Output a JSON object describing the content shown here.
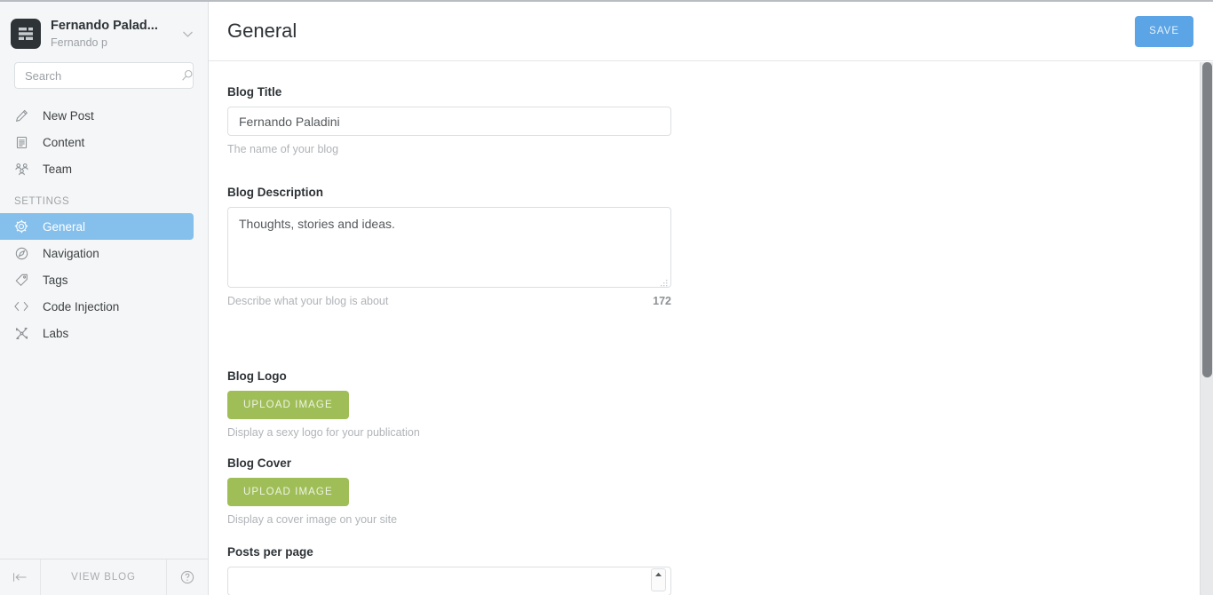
{
  "sidebar": {
    "brand": {
      "logo_icon": "ghost-logo-icon",
      "title": "Fernando Palad...",
      "subtitle": "Fernando p",
      "chevron_icon": "chevron-down-icon"
    },
    "search": {
      "placeholder": "Search",
      "value": "",
      "icon": "search-icon"
    },
    "primary_items": [
      {
        "label": "New Post",
        "icon": "pencil-icon",
        "active": false
      },
      {
        "label": "Content",
        "icon": "document-icon",
        "active": false
      },
      {
        "label": "Team",
        "icon": "team-icon",
        "active": false
      }
    ],
    "settings_heading": "SETTINGS",
    "settings_items": [
      {
        "label": "General",
        "icon": "gear-icon",
        "active": true
      },
      {
        "label": "Navigation",
        "icon": "compass-icon",
        "active": false
      },
      {
        "label": "Tags",
        "icon": "tag-icon",
        "active": false
      },
      {
        "label": "Code Injection",
        "icon": "code-brackets-icon",
        "active": false
      },
      {
        "label": "Labs",
        "icon": "tools-icon",
        "active": false
      }
    ],
    "footer": {
      "collapse_icon": "collapse-left-icon",
      "view_blog_label": "VIEW BLOG",
      "help_icon": "question-circle-icon"
    }
  },
  "header": {
    "title": "General",
    "save_label": "SAVE"
  },
  "form": {
    "blog_title": {
      "label": "Blog Title",
      "value": "Fernando Paladini",
      "placeholder": "Site title",
      "hint": "The name of your blog"
    },
    "blog_description": {
      "label": "Blog Description",
      "value": "Thoughts, stories and ideas.",
      "placeholder": "Site description",
      "hint": "Describe what your blog is about",
      "counter": "172"
    },
    "blog_logo": {
      "label": "Blog Logo",
      "button_label": "UPLOAD IMAGE",
      "hint": "Display a sexy logo for your publication"
    },
    "blog_cover": {
      "label": "Blog Cover",
      "button_label": "UPLOAD IMAGE",
      "hint": "Display a cover image on your site"
    },
    "posts_per_page": {
      "label": "Posts per page",
      "value": ""
    }
  },
  "colors": {
    "accent_blue": "#85bfeb",
    "save_blue": "#5ba4e5",
    "upload_green": "#9fbe57",
    "sidebar_bg": "#f5f6f7"
  }
}
